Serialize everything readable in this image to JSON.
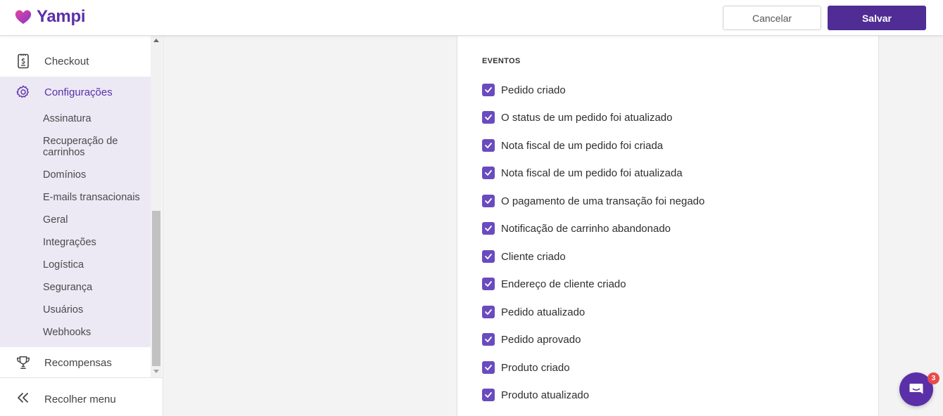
{
  "brand": {
    "name": "Yampi",
    "accent": "#5b2fa8",
    "checkbox_color": "#6a4bbf"
  },
  "header": {
    "cancel_label": "Cancelar",
    "save_label": "Salvar"
  },
  "sidebar": {
    "items": [
      {
        "label": "Checkout",
        "icon": "receipt-icon"
      },
      {
        "label": "Configurações",
        "icon": "gear-icon",
        "active": true
      },
      {
        "label": "Recompensas",
        "icon": "trophy-icon"
      }
    ],
    "submenu": [
      "Assinatura",
      "Recuperação de carrinhos",
      "Domínios",
      "E-mails transacionais",
      "Geral",
      "Integrações",
      "Logística",
      "Segurança",
      "Usuários",
      "Webhooks"
    ],
    "collapse_label": "Recolher menu"
  },
  "events_section": {
    "title": "EVENTOS",
    "events": [
      {
        "label": "Pedido criado",
        "checked": true
      },
      {
        "label": "O status de um pedido foi atualizado",
        "checked": true
      },
      {
        "label": "Nota fiscal de um pedido foi criada",
        "checked": true
      },
      {
        "label": "Nota fiscal de um pedido foi atualizada",
        "checked": true
      },
      {
        "label": "O pagamento de uma transação foi negado",
        "checked": true
      },
      {
        "label": "Notificação de carrinho abandonado",
        "checked": true
      },
      {
        "label": "Cliente criado",
        "checked": true
      },
      {
        "label": "Endereço de cliente criado",
        "checked": true
      },
      {
        "label": "Pedido atualizado",
        "checked": true
      },
      {
        "label": "Pedido aprovado",
        "checked": true
      },
      {
        "label": "Produto criado",
        "checked": true
      },
      {
        "label": "Produto atualizado",
        "checked": true
      }
    ]
  },
  "chat": {
    "badge_count": "3",
    "icon": "chat-icon"
  }
}
